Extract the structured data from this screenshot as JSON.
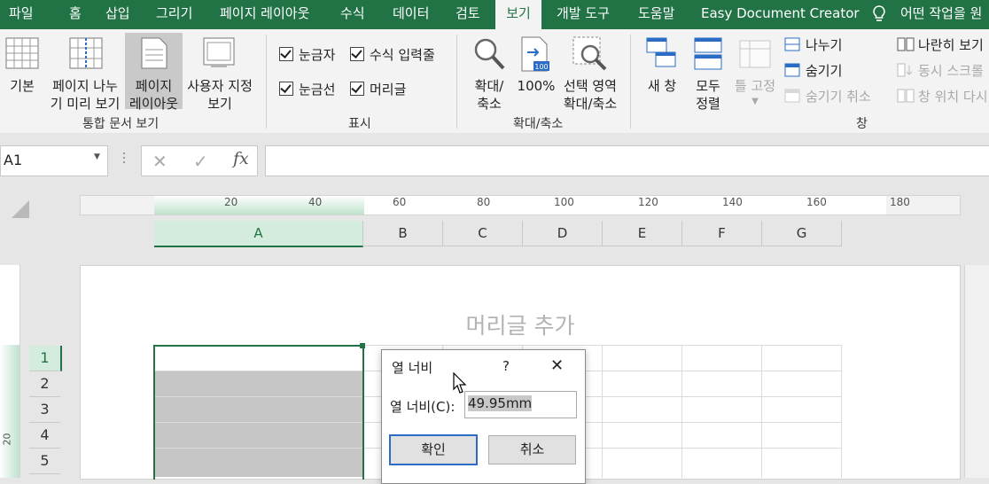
{
  "tabs": [
    {
      "label": "파일",
      "active": false
    },
    {
      "label": "홈",
      "active": false
    },
    {
      "label": "삽입",
      "active": false
    },
    {
      "label": "그리기",
      "active": false
    },
    {
      "label": "페이지 레이아웃",
      "active": false
    },
    {
      "label": "수식",
      "active": false
    },
    {
      "label": "데이터",
      "active": false
    },
    {
      "label": "검토",
      "active": false
    },
    {
      "label": "보기",
      "active": true
    },
    {
      "label": "개발 도구",
      "active": false
    },
    {
      "label": "도움말",
      "active": false
    },
    {
      "label": "Easy Document Creator",
      "active": false
    }
  ],
  "tell_me": "어떤 작업을 원",
  "ribbon": {
    "workbook_views": {
      "group": "통합 문서 보기",
      "normal": "기본",
      "page_break_1": "페이지 나누",
      "page_break_2": "기 미리 보기",
      "page_layout_1": "페이지",
      "page_layout_2": "레이아웃",
      "custom_1": "사용자 지정",
      "custom_2": "보기"
    },
    "show": {
      "group": "표시",
      "ruler": "눈금자",
      "formula_bar": "수식 입력줄",
      "gridlines": "눈금선",
      "headings": "머리글"
    },
    "zoom": {
      "group": "확대/축소",
      "zoom_1": "확대/",
      "zoom_2": "축소",
      "hundred": "100%",
      "icon_badge": "100",
      "selection_1": "선택 영역",
      "selection_2": "확대/축소"
    },
    "window": {
      "group": "창",
      "new_window": "새 창",
      "arrange_1": "모두",
      "arrange_2": "정렬",
      "freeze": "틀 고정",
      "split": "나누기",
      "hide": "숨기기",
      "unhide": "숨기기 취소",
      "side_by_side": "나란히 보기",
      "sync_scroll": "동시 스크롤",
      "reset_position": "창 위치 다시"
    }
  },
  "formula_bar": {
    "name_box": "A1",
    "fx": "fx",
    "formula": ""
  },
  "ruler": {
    "labels": [
      "20",
      "40",
      "60",
      "80",
      "100",
      "120",
      "140",
      "160",
      "180"
    ]
  },
  "vertical_ruler": {
    "label": "20"
  },
  "columns": [
    "A",
    "B",
    "C",
    "D",
    "E",
    "F",
    "G"
  ],
  "rows": [
    "1",
    "2",
    "3",
    "4",
    "5"
  ],
  "header_placeholder": "머리글 추가",
  "dialog": {
    "title": "열 너비",
    "help": "?",
    "close": "✕",
    "field_label": "열 너비(C):",
    "field_value": "49.95mm",
    "ok": "확인",
    "cancel": "취소"
  },
  "colors": {
    "accent": "#217346",
    "selection": "#d3ecdd",
    "selected_cells": "#c6c6c6"
  }
}
